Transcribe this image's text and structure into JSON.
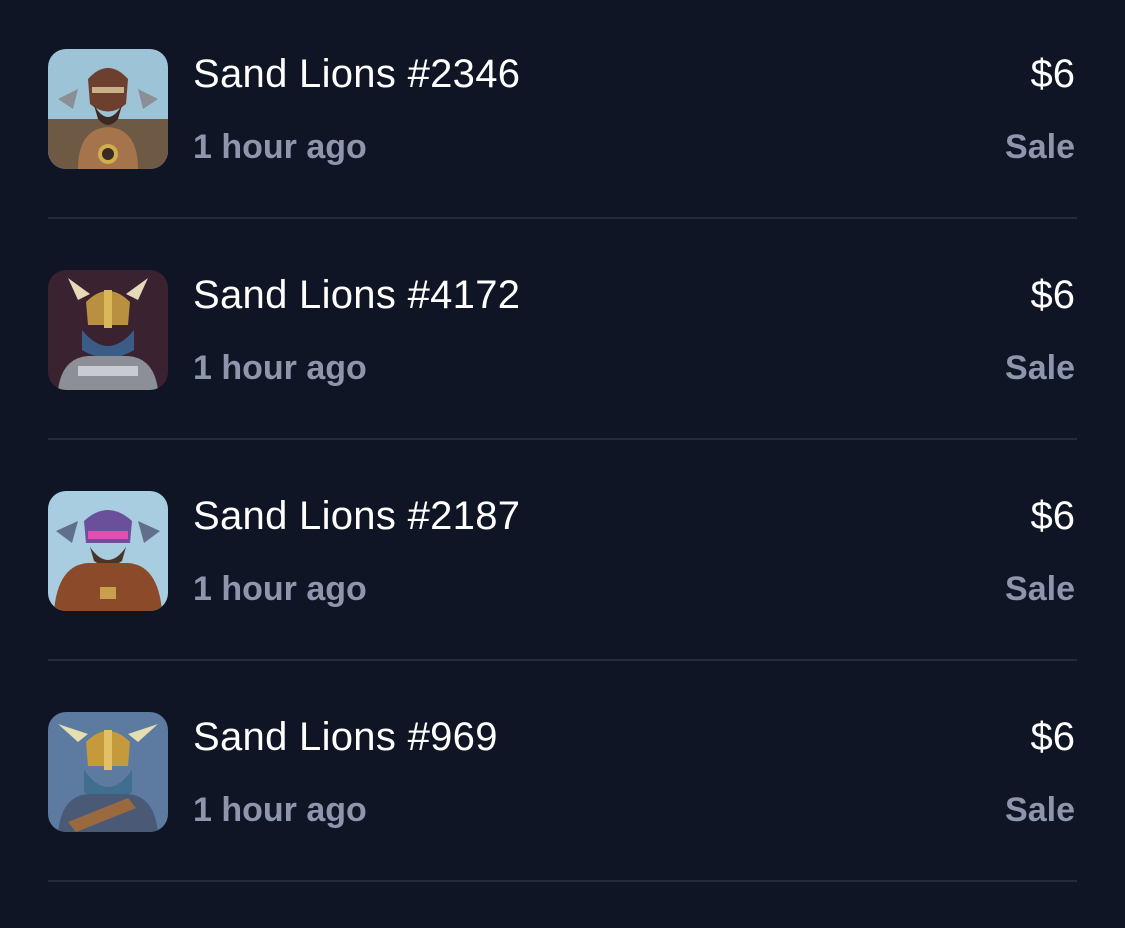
{
  "activity": [
    {
      "name": "Sand Lions #2346",
      "time": "1 hour ago",
      "price": "$6",
      "event": "Sale",
      "thumbnail": "warrior-avatar-icon"
    },
    {
      "name": "Sand Lions #4172",
      "time": "1 hour ago",
      "price": "$6",
      "event": "Sale",
      "thumbnail": "warrior-avatar-icon"
    },
    {
      "name": "Sand Lions #2187",
      "time": "1 hour ago",
      "price": "$6",
      "event": "Sale",
      "thumbnail": "warrior-avatar-icon"
    },
    {
      "name": "Sand Lions #969",
      "time": "1 hour ago",
      "price": "$6",
      "event": "Sale",
      "thumbnail": "warrior-avatar-icon"
    }
  ],
  "colors": {
    "background": "#0f1524",
    "divider": "#242c3b",
    "primary_text": "#ffffff",
    "secondary_text": "#8e96ad"
  }
}
